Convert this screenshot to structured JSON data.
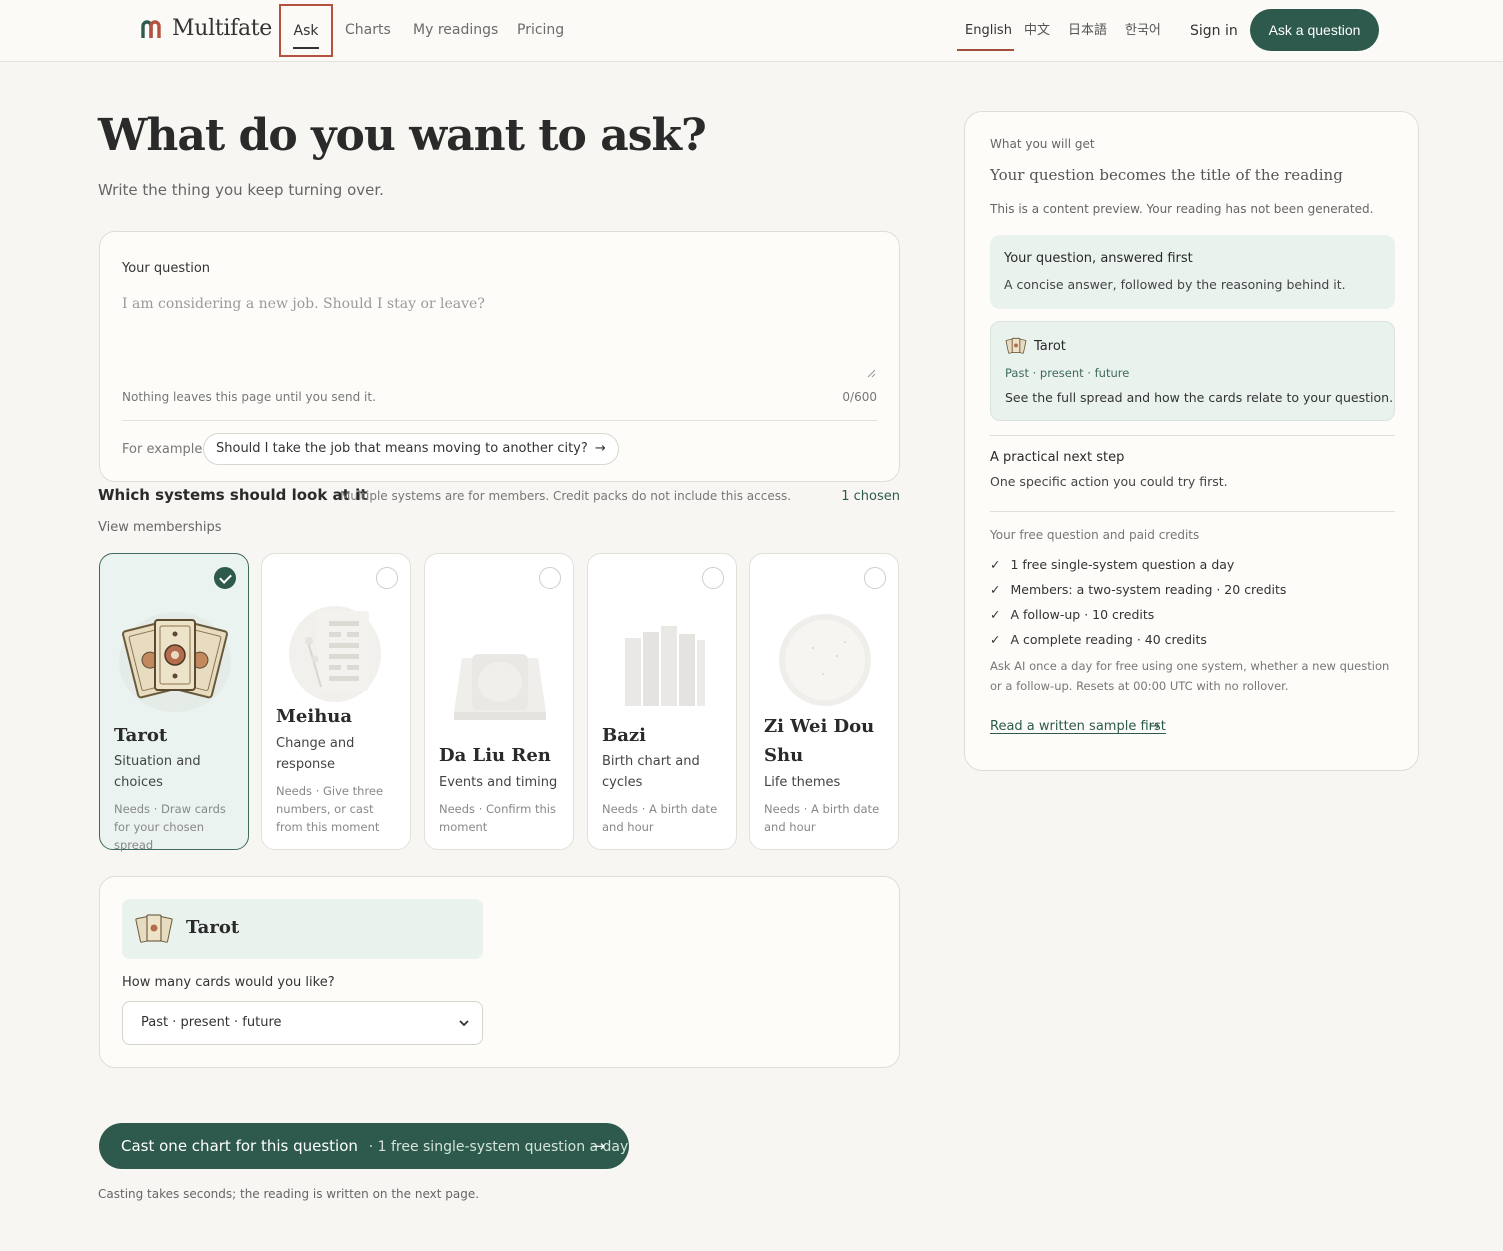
{
  "header": {
    "logo_text": "Multifate",
    "nav": [
      "Ask",
      "Charts",
      "My readings",
      "Pricing"
    ],
    "languages": [
      "English",
      "中文",
      "日本語",
      "한국어"
    ],
    "active_language": "English",
    "sign_in": "Sign in",
    "ask_button": "Ask a question",
    "accent_color": "#2d5a4c"
  },
  "page": {
    "title": "What do you want to ask?",
    "subtitle": "Write the thing you keep turning over."
  },
  "question": {
    "label": "Your question",
    "placeholder": "I am considering a new job. Should I stay or leave?",
    "privacy": "Nothing leaves this page until you send it.",
    "count": "0/600",
    "example_label": "For example",
    "example_text": "Should I take the job that means moving to another city?"
  },
  "systems": {
    "heading": "Which systems should look at it",
    "note": "Multiple systems are for members. Credit packs do not include this access.",
    "chosen": "1 chosen",
    "memberships_link": "View memberships",
    "items": [
      {
        "name": "Tarot",
        "desc": "Situation and choices",
        "needs": "Needs · Draw cards for your chosen spread",
        "selected": true,
        "icon": "tarot-cards-icon"
      },
      {
        "name": "Meihua",
        "desc": "Change and response",
        "needs": "Needs · Give three numbers, or cast from this moment",
        "selected": false,
        "icon": "hexagram-scroll-icon"
      },
      {
        "name": "Da Liu Ren",
        "desc": "Events and timing",
        "needs": "Needs · Confirm this moment",
        "selected": false,
        "icon": "divination-board-icon"
      },
      {
        "name": "Bazi",
        "desc": "Birth chart and cycles",
        "needs": "Needs · A birth date and hour",
        "selected": false,
        "icon": "pillars-icon"
      },
      {
        "name": "Zi Wei Dou Shu",
        "desc": "Life themes",
        "needs": "Needs · A birth date and hour",
        "selected": false,
        "icon": "star-plate-icon"
      }
    ]
  },
  "tarot_options": {
    "name": "Tarot",
    "question": "How many cards would you like?",
    "selected_spread": "Past · present · future"
  },
  "cta": {
    "label": "Cast one chart for this question",
    "sub": "· 1 free single-system question a day",
    "note": "Casting takes seconds; the reading is written on the next page."
  },
  "panel": {
    "kicker": "What you will get",
    "title": "Your question becomes the title of the reading",
    "subtitle": "This is a content preview. Your reading has not been generated.",
    "box1_title": "Your question, answered first",
    "box1_text": "A concise answer, followed by the reasoning behind it.",
    "box2_name": "Tarot",
    "box2_spread": "Past · present · future",
    "box2_text": "See the full spread and how the cards relate to your question.",
    "step_title": "A practical next step",
    "step_text": "One specific action you could try first.",
    "credits_title": "Your free question and paid credits",
    "credits": [
      "1 free single-system question a day",
      "Members: a two-system reading · 20 credits",
      "A follow-up · 10 credits",
      "A complete reading · 40 credits"
    ],
    "note": "Ask AI once a day for free using one system, whether a new question or a follow-up. Resets at 00:00 UTC with no rollover.",
    "sample_link": "Read a written sample first"
  }
}
